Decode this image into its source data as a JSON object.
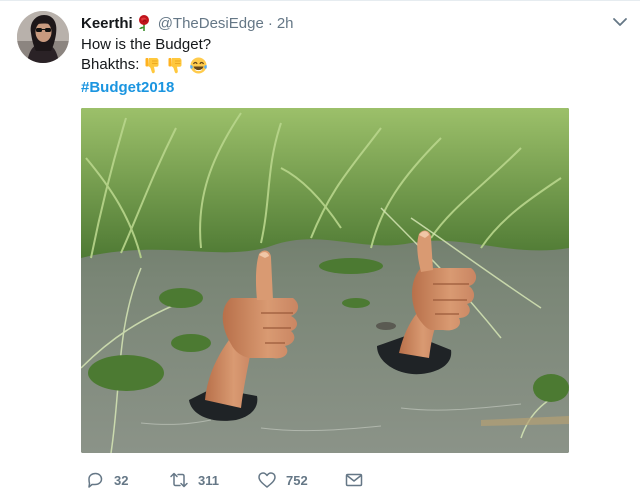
{
  "tweet": {
    "display_name": "Keerthi",
    "handle": "@TheDesiEdge",
    "separator": "·",
    "time": "2h",
    "text_line1": "How is the Budget?",
    "text_line2": "Bhakths:",
    "hashtag": "#Budget2018",
    "icons": {
      "avatar": "profile-photo",
      "name_emoji": "rose-emoji",
      "caret": "chevron-down-icon",
      "line2_emojis": [
        "thumbs-down-emoji",
        "thumbs-down-emoji",
        "face-with-tears-of-joy-emoji"
      ],
      "media": "thumbs-up-hands-in-swamp-photo"
    }
  },
  "actions": {
    "reply_count": "32",
    "retweet_count": "311",
    "like_count": "752",
    "icons": [
      "reply-icon",
      "retweet-icon",
      "like-icon",
      "message-icon"
    ]
  },
  "colors": {
    "link": "#1b95e0",
    "secondary_text": "#657786",
    "primary_text": "#14171a"
  }
}
